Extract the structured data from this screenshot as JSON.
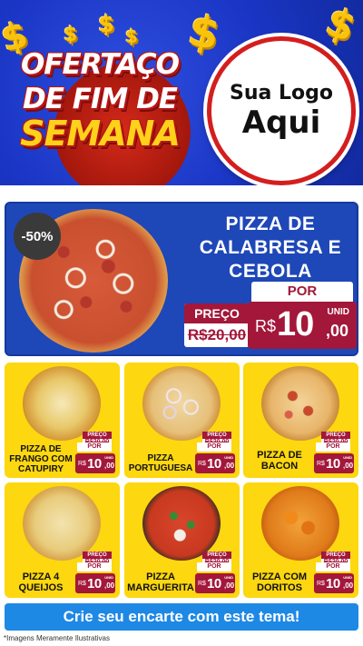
{
  "header": {
    "headline": [
      "OFERTAÇO",
      "DE FIM DE",
      "SEMANA"
    ],
    "logo_placeholder": [
      "Sua Logo",
      "Aqui"
    ]
  },
  "featured": {
    "discount": "-50%",
    "name": "PIZZA DE CALABRESA E CEBOLA",
    "por_label": "POR",
    "preco_label": "PREÇO",
    "old_price": "R$20,00",
    "currency": "R$",
    "price_int": "10",
    "price_dec": ",00",
    "unit": "UNID"
  },
  "products": [
    {
      "name": "PIZZA DE FRANGO COM CATUPIRY",
      "por": "POR",
      "preco": "PREÇO",
      "old_price": "R$20,00",
      "currency": "R$",
      "price_int": "10",
      "price_dec": ",00",
      "unit": "UNID"
    },
    {
      "name": "PIZZA PORTUGUESA",
      "por": "POR",
      "preco": "PREÇO",
      "old_price": "R$20,00",
      "currency": "R$",
      "price_int": "10",
      "price_dec": ",00",
      "unit": "UNID"
    },
    {
      "name": "PIZZA DE BACON",
      "por": "POR",
      "preco": "PREÇO",
      "old_price": "R$20,00",
      "currency": "R$",
      "price_int": "10",
      "price_dec": ",00",
      "unit": "UNID"
    },
    {
      "name": "PIZZA 4 QUEIJOS",
      "por": "POR",
      "preco": "PREÇO",
      "old_price": "R$20,00",
      "currency": "R$",
      "price_int": "10",
      "price_dec": ",00",
      "unit": "UNID"
    },
    {
      "name": "PIZZA MARGUERITA",
      "por": "POR",
      "preco": "PREÇO",
      "old_price": "R$20,00",
      "currency": "R$",
      "price_int": "10",
      "price_dec": ",00",
      "unit": "UNID"
    },
    {
      "name": "PIZZA COM DORITOS",
      "por": "POR",
      "preco": "PREÇO",
      "old_price": "R$20,00",
      "currency": "R$",
      "price_int": "10",
      "price_dec": ",00",
      "unit": "UNID"
    }
  ],
  "cta_label": "Crie seu encarte com este tema!",
  "disclaimer": "*Imagens Meramente Ilustrativas",
  "colors": {
    "header_blue": "#1a35c4",
    "accent_yellow": "#fdd70f",
    "price_red": "#a3173a",
    "cta_blue": "#1e88e5"
  },
  "icons": [
    "dollar-sign-icon"
  ]
}
